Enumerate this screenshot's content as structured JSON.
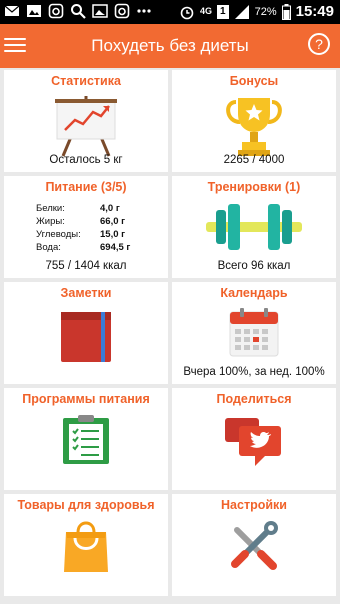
{
  "status_bar": {
    "network": "4G",
    "sim": "1",
    "battery": "72%",
    "time": "15:49"
  },
  "app_bar": {
    "title": "Похудеть без диеты",
    "help_label": "?"
  },
  "tiles": [
    {
      "title": "Статистика",
      "caption": "Осталось 5 кг"
    },
    {
      "title": "Бонусы",
      "caption": "2265 / 4000"
    },
    {
      "title": "Питание (3/5)",
      "caption": "755 / 1404 ккал",
      "nutrients": [
        {
          "label": "Белки:",
          "value": "4,0 г"
        },
        {
          "label": "Жиры:",
          "value": "66,0 г"
        },
        {
          "label": "Углеводы:",
          "value": "15,0 г"
        },
        {
          "label": "Вода:",
          "value": "694,5 г"
        }
      ]
    },
    {
      "title": "Тренировки (1)",
      "caption": "Всего 96 ккал"
    },
    {
      "title": "Заметки",
      "caption": ""
    },
    {
      "title": "Календарь",
      "caption": "Вчера 100%, за нед. 100%"
    },
    {
      "title": "Программы питания",
      "caption": ""
    },
    {
      "title": "Поделиться",
      "caption": ""
    },
    {
      "title": "Товары для здоровья",
      "caption": ""
    },
    {
      "title": "Настройки",
      "caption": ""
    }
  ],
  "colors": {
    "accent": "#f26a32",
    "title_text": "#f0622a",
    "background": "#e9e9e9"
  },
  "icons": [
    "chart-easel-icon",
    "trophy-icon",
    "dumbbell-icon",
    "notebook-icon",
    "calendar-icon",
    "clipboard-icon",
    "twitter-share-icon",
    "shopping-bag-icon",
    "tools-icon"
  ]
}
